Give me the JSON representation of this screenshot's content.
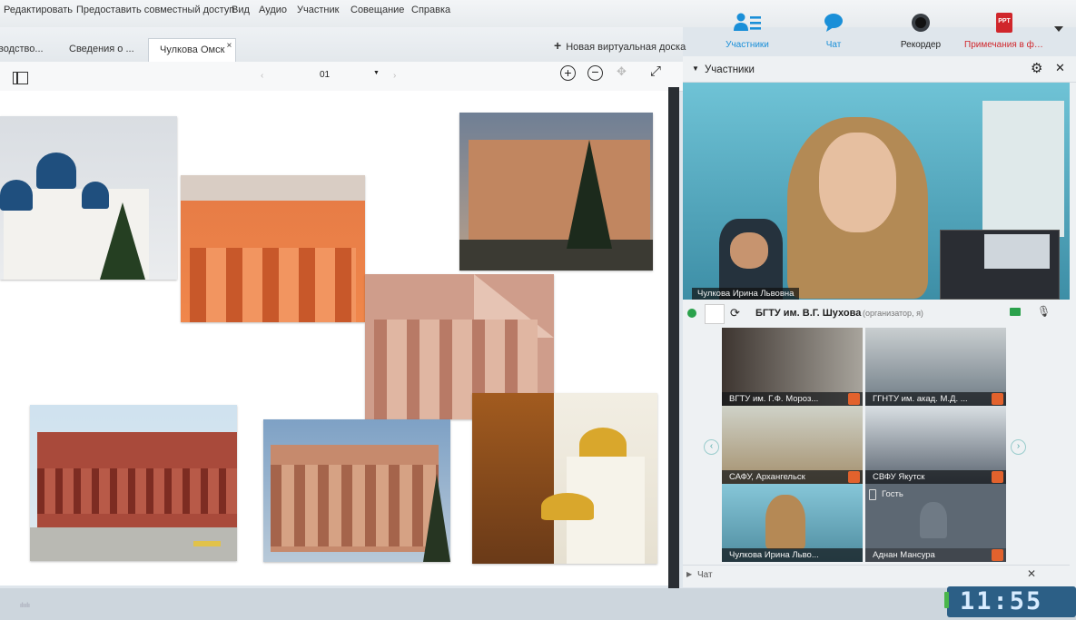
{
  "menu": {
    "items": [
      "Редактировать",
      "Предоставить совместный доступ",
      "Вид",
      "Аудио",
      "Участник",
      "Совещание",
      "Справка"
    ]
  },
  "toolbar_right": {
    "participants_label": "Участники",
    "chat_label": "Чат",
    "recorder_label": "Рекордер",
    "notes_label": "Примечания в фо...",
    "notes_icon_text": "PPT"
  },
  "tabs": {
    "items": [
      "водство...",
      "Сведения о ...",
      "Чулкова Омск"
    ],
    "new_board": "Новая виртуальная доска"
  },
  "whiteboard": {
    "page": "01"
  },
  "participants_panel": {
    "title": "Участники",
    "main_video_label": "Чулкова Ирина Львовна",
    "host_name": "БГТУ им. В.Г. Шухова",
    "host_role": "(организатор, я)",
    "grid": [
      {
        "label": "ВГТУ им. Г.Ф. Мороз..."
      },
      {
        "label": "ГГНТУ им. акад. М.Д. ..."
      },
      {
        "label": "САФУ, Архангельск"
      },
      {
        "label": "СВФУ Якутск"
      },
      {
        "label": "Чулкова Ирина Льво..."
      },
      {
        "label": "Аднан Мансура"
      }
    ],
    "guest_label": "Гость",
    "chat_label": "Чат"
  },
  "clock": {
    "time": "11:55"
  },
  "colors": {
    "accent_blue": "#1a8fd8",
    "notes_red": "#d0262b",
    "mic_orange": "#e2622d",
    "video_green": "#2aa14b"
  }
}
